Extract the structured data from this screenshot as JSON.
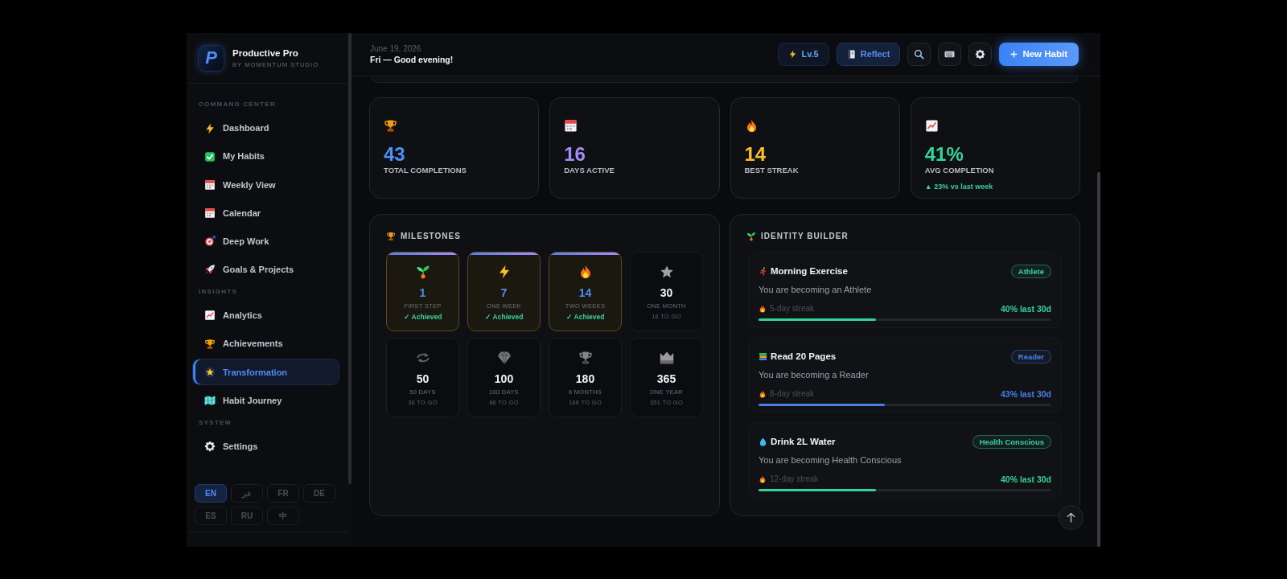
{
  "sidebar": {
    "brand": {
      "logo": "P",
      "name": "Productive Pro",
      "subtitle": "BY MOMENTUM STUDIO"
    },
    "sections": [
      {
        "label": "COMMAND CENTER",
        "items": [
          {
            "label": "Dashboard",
            "selected": false
          },
          {
            "label": "My Habits",
            "selected": false
          },
          {
            "label": "Weekly View",
            "selected": false
          },
          {
            "label": "Calendar",
            "selected": false
          },
          {
            "label": "Deep Work",
            "selected": false
          },
          {
            "label": "Goals & Projects",
            "selected": false
          }
        ]
      },
      {
        "label": "INSIGHTS",
        "items": [
          {
            "label": "Analytics",
            "selected": false
          },
          {
            "label": "Achievements",
            "selected": false
          },
          {
            "label": "Transformation",
            "selected": true
          },
          {
            "label": "Habit Journey",
            "selected": false
          }
        ]
      },
      {
        "label": "SYSTEM",
        "items": [
          {
            "label": "Settings",
            "selected": false
          }
        ]
      }
    ],
    "languages": [
      {
        "label": "EN",
        "selected": true
      },
      {
        "label": "عر",
        "selected": false
      },
      {
        "label": "FR",
        "selected": false
      },
      {
        "label": "DE",
        "selected": false
      },
      {
        "label": "ES",
        "selected": false
      },
      {
        "label": "RU",
        "selected": false
      },
      {
        "label": "中",
        "selected": false
      }
    ]
  },
  "header": {
    "date": "June 19, 2026",
    "greeting": "Fri — Good evening!",
    "level_badge": "Lv.5",
    "reflect_button": "Reflect",
    "new_habit_button": "New Habit"
  },
  "stats": [
    {
      "value": "43",
      "label": "TOTAL COMPLETIONS",
      "color": "#4f8ef7"
    },
    {
      "value": "16",
      "label": "DAYS ACTIVE",
      "color": "#a78bfa"
    },
    {
      "value": "14",
      "label": "BEST STREAK",
      "color": "#fbbf24"
    },
    {
      "value": "41%",
      "label": "AVG COMPLETION",
      "color": "#34d399",
      "trend": "▲ 23% vs last week"
    }
  ],
  "milestones": {
    "title": "MILESTONES",
    "items": [
      {
        "value": "1",
        "label": "FIRST STEP",
        "status": "✓ Achieved",
        "achieved": true
      },
      {
        "value": "7",
        "label": "ONE WEEK",
        "status": "✓ Achieved",
        "achieved": true
      },
      {
        "value": "14",
        "label": "TWO WEEKS",
        "status": "✓ Achieved",
        "achieved": true
      },
      {
        "value": "30",
        "label": "ONE MONTH",
        "status": "16 TO GO",
        "achieved": false
      },
      {
        "value": "50",
        "label": "50 DAYS",
        "status": "36 TO GO",
        "achieved": false
      },
      {
        "value": "100",
        "label": "100 DAYS",
        "status": "86 TO GO",
        "achieved": false
      },
      {
        "value": "180",
        "label": "6 MONTHS",
        "status": "166 TO GO",
        "achieved": false
      },
      {
        "value": "365",
        "label": "ONE YEAR",
        "status": "351 TO GO",
        "achieved": false
      }
    ]
  },
  "identity_builder": {
    "title": "IDENTITY BUILDER",
    "items": [
      {
        "habit": "Morning Exercise",
        "identity": "Athlete",
        "statement": "You are becoming an Athlete",
        "streak": "5-day streak",
        "rate": "40% last 30d",
        "level": 0.4,
        "color": "#34d399"
      },
      {
        "habit": "Read 20 Pages",
        "identity": "Reader",
        "statement": "You are becoming a Reader",
        "streak": "8-day streak",
        "rate": "43% last 30d",
        "level": 0.43,
        "color": "#4a7ff0"
      },
      {
        "habit": "Drink 2L Water",
        "identity": "Health Conscious",
        "statement": "You are becoming Health Conscious",
        "streak": "12-day streak",
        "rate": "40% last 30d",
        "level": 0.4,
        "color": "#34d399"
      }
    ]
  }
}
